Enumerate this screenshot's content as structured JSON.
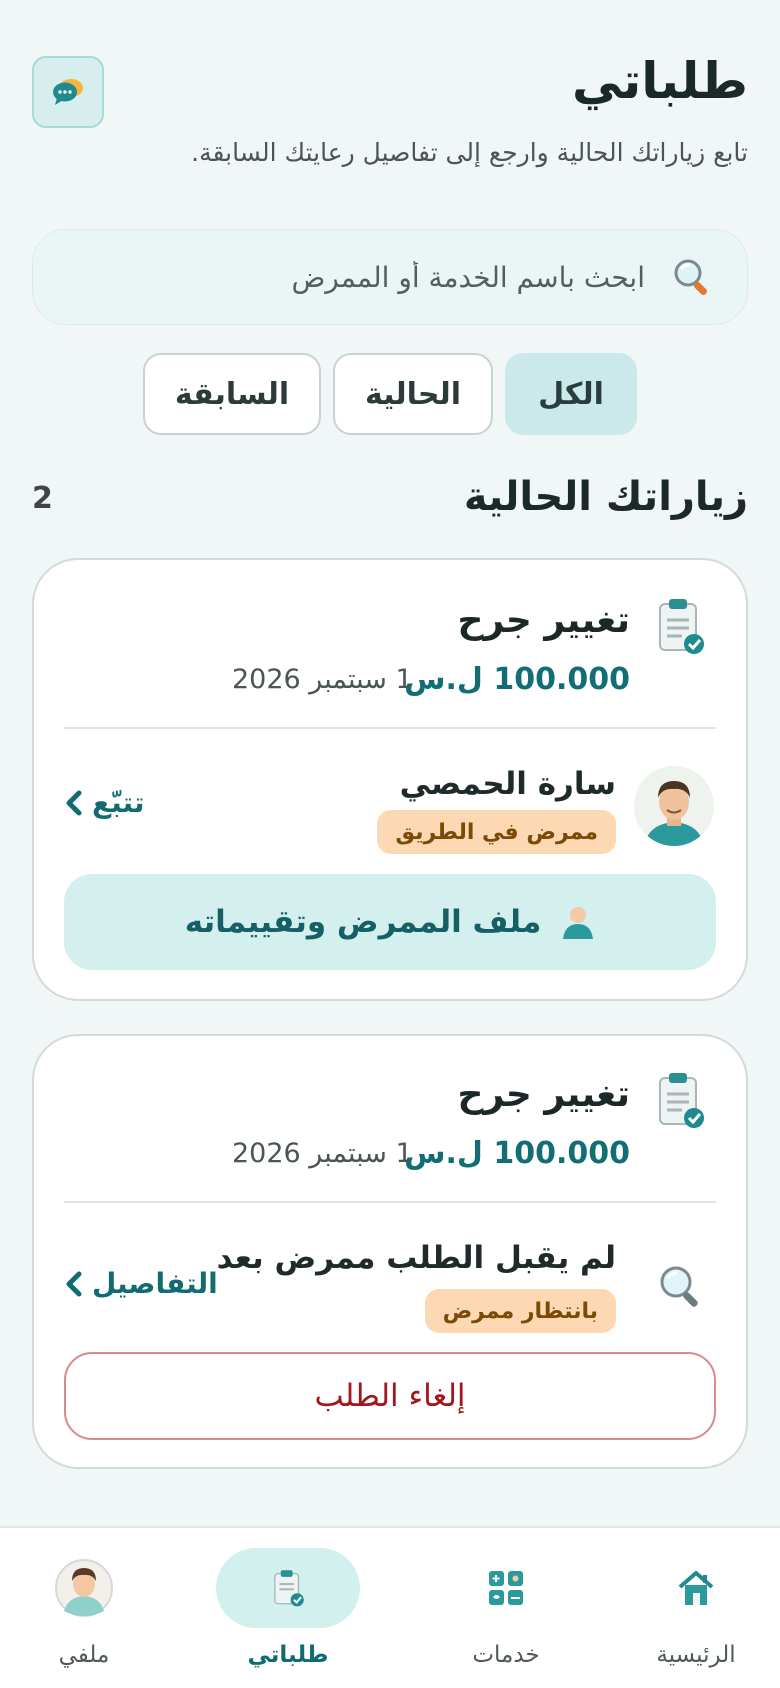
{
  "header": {
    "title": "طلباتي",
    "subtitle": "تابع زياراتك الحالية وارجع إلى تفاصيل رعايتك السابقة.",
    "chat_icon": "chat-bubbles-icon"
  },
  "search": {
    "placeholder": "ابحث باسم الخدمة أو الممرض",
    "icon": "magnifier-icon"
  },
  "tabs": [
    {
      "label": "الكل",
      "active": true
    },
    {
      "label": "الحالية",
      "active": false
    },
    {
      "label": "السابقة",
      "active": false
    }
  ],
  "section": {
    "title": "زياراتك الحالية",
    "count": "2"
  },
  "orders": [
    {
      "title": "تغيير جرح",
      "price": "100.000 ل.س",
      "date": "1 سبتمبر 2026",
      "nurse_name": "سارة الحمصي",
      "status": "ممرض في الطريق",
      "action": "تتبّع",
      "button": "ملف الممرض وتقييماته"
    },
    {
      "title": "تغيير جرح",
      "price": "100.000 ل.س",
      "date": "1 سبتمبر 2026",
      "message": "لم يقبل الطلب ممرض بعد",
      "status": "بانتظار ممرض",
      "action": "التفاصيل",
      "button": "إلغاء الطلب"
    }
  ],
  "bottom_nav": [
    {
      "label": "الرئيسية",
      "icon": "home-icon",
      "active": false
    },
    {
      "label": "خدمات",
      "icon": "services-icon",
      "active": false
    },
    {
      "label": "طلباتي",
      "icon": "clipboard-icon",
      "active": true
    },
    {
      "label": "ملفي",
      "icon": "profile-avatar-icon",
      "active": false
    }
  ],
  "colors": {
    "accent": "#116b71",
    "background": "#f1f7f7",
    "badge_bg": "#fcd8b3",
    "cancel_red": "#a3141b"
  }
}
